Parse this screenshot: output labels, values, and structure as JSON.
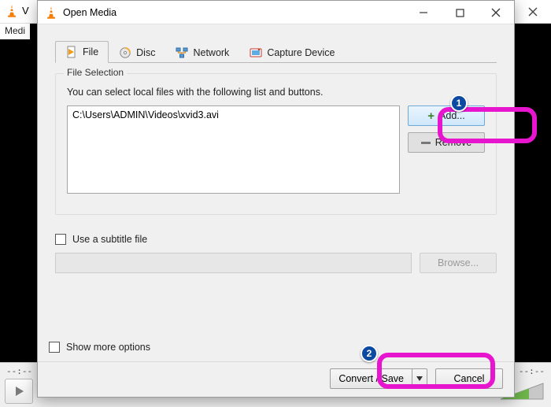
{
  "background": {
    "title_fragment": "V",
    "menu_fragment": "Medi",
    "time_left": "--:--",
    "time_right": "--:--"
  },
  "dialog": {
    "title": "Open Media",
    "tabs": {
      "file": "File",
      "disc": "Disc",
      "network": "Network",
      "capture": "Capture Device"
    },
    "file_selection": {
      "group_label": "File Selection",
      "hint": "You can select local files with the following list and buttons.",
      "files": [
        "C:\\Users\\ADMIN\\Videos\\xvid3.avi"
      ],
      "add_label": "Add...",
      "remove_label": "Remove"
    },
    "subtitle": {
      "checkbox_label": "Use a subtitle file",
      "browse_label": "Browse..."
    },
    "show_more_label": "Show more options",
    "footer": {
      "convert_label": "Convert / Save",
      "cancel_label": "Cancel"
    }
  },
  "callouts": {
    "one": "1",
    "two": "2"
  }
}
